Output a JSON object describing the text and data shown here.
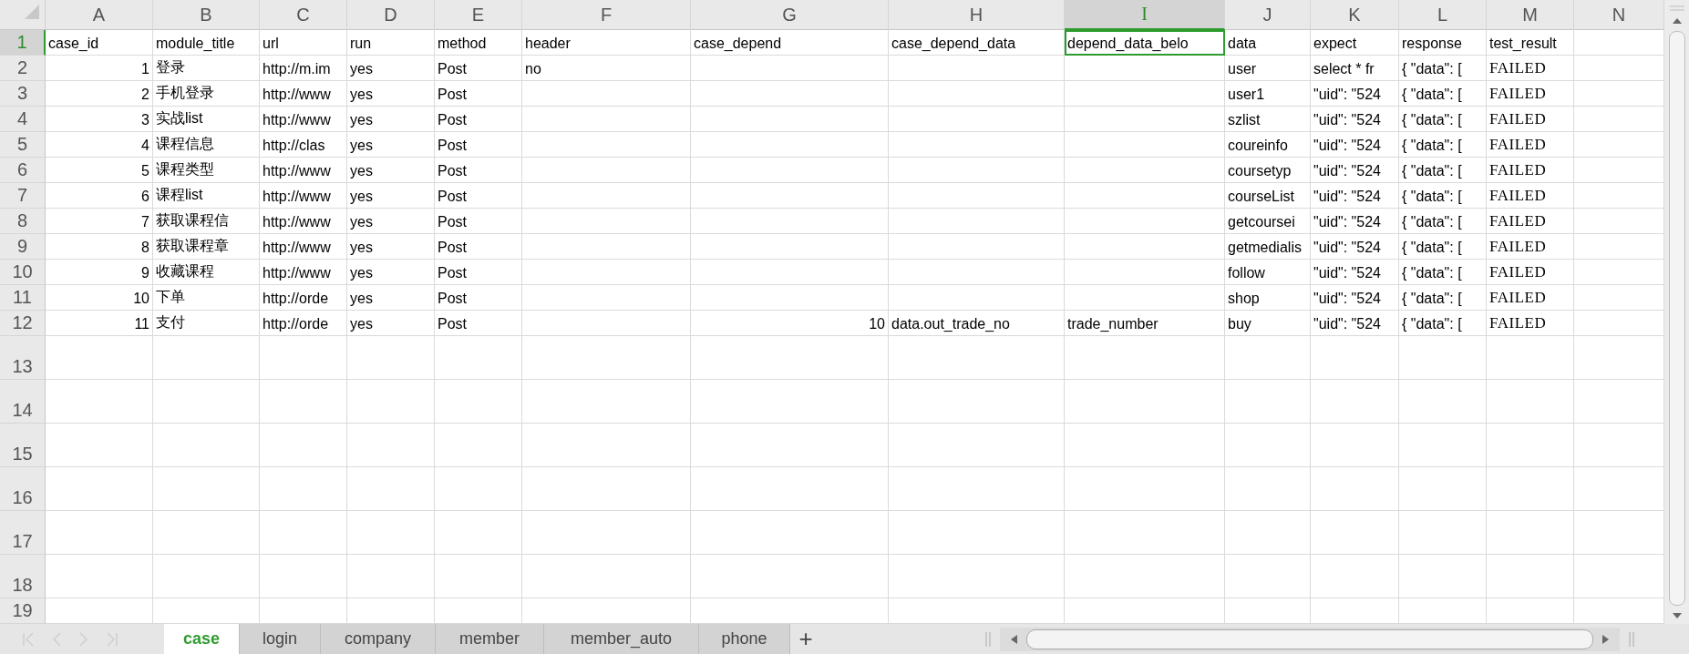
{
  "columns": [
    {
      "label": "A",
      "selected": false
    },
    {
      "label": "B",
      "selected": false
    },
    {
      "label": "C",
      "selected": false
    },
    {
      "label": "D",
      "selected": false
    },
    {
      "label": "E",
      "selected": false
    },
    {
      "label": "F",
      "selected": false
    },
    {
      "label": "G",
      "selected": false
    },
    {
      "label": "H",
      "selected": false
    },
    {
      "label": "I",
      "selected": true
    },
    {
      "label": "J",
      "selected": false
    },
    {
      "label": "K",
      "selected": false
    },
    {
      "label": "L",
      "selected": false
    },
    {
      "label": "M",
      "selected": false
    },
    {
      "label": "N",
      "selected": false
    }
  ],
  "rows": [
    {
      "number": "1",
      "selected": true,
      "cells": [
        "case_id",
        "module_title",
        "url",
        "run",
        "method",
        "header",
        "case_depend",
        "case_depend_data",
        "depend_data_belo",
        "data",
        "expect",
        "response",
        "test_result",
        null
      ]
    },
    {
      "number": "2",
      "selected": false,
      "cells": [
        {
          "kind": "number",
          "text": "1"
        },
        "登录",
        "http://m.im",
        "yes",
        "Post",
        "no",
        null,
        null,
        null,
        "user",
        "select * fr",
        "{  \"data\": [",
        {
          "kind": "result",
          "text": "FAILED"
        },
        null
      ]
    },
    {
      "number": "3",
      "selected": false,
      "cells": [
        {
          "kind": "number",
          "text": "2"
        },
        "手机登录",
        "http://www",
        "yes",
        "Post",
        null,
        null,
        null,
        null,
        "user1",
        "\"uid\": \"524",
        "{  \"data\": [",
        {
          "kind": "result",
          "text": "FAILED"
        },
        null
      ]
    },
    {
      "number": "4",
      "selected": false,
      "cells": [
        {
          "kind": "number",
          "text": "3"
        },
        "实战list",
        "http://www",
        "yes",
        "Post",
        null,
        null,
        null,
        null,
        "szlist",
        "\"uid\": \"524",
        "{  \"data\": [",
        {
          "kind": "result",
          "text": "FAILED"
        },
        null
      ]
    },
    {
      "number": "5",
      "selected": false,
      "cells": [
        {
          "kind": "number",
          "text": "4"
        },
        "课程信息",
        "http://clas",
        "yes",
        "Post",
        null,
        null,
        null,
        null,
        "coureinfo",
        "\"uid\": \"524",
        "{  \"data\": [",
        {
          "kind": "result",
          "text": "FAILED"
        },
        null
      ]
    },
    {
      "number": "6",
      "selected": false,
      "cells": [
        {
          "kind": "number",
          "text": "5"
        },
        "课程类型",
        "http://www",
        "yes",
        "Post",
        null,
        null,
        null,
        null,
        "coursetyp",
        "\"uid\": \"524",
        "{  \"data\": [",
        {
          "kind": "result",
          "text": "FAILED"
        },
        null
      ]
    },
    {
      "number": "7",
      "selected": false,
      "cells": [
        {
          "kind": "number",
          "text": "6"
        },
        "课程list",
        "http://www",
        "yes",
        "Post",
        null,
        null,
        null,
        null,
        "courseList",
        "\"uid\": \"524",
        "{  \"data\": [",
        {
          "kind": "result",
          "text": "FAILED"
        },
        null
      ]
    },
    {
      "number": "8",
      "selected": false,
      "cells": [
        {
          "kind": "number",
          "text": "7"
        },
        "获取课程信",
        "http://www",
        "yes",
        "Post",
        null,
        null,
        null,
        null,
        "getcoursei",
        "\"uid\": \"524",
        "{  \"data\": [",
        {
          "kind": "result",
          "text": "FAILED"
        },
        null
      ]
    },
    {
      "number": "9",
      "selected": false,
      "cells": [
        {
          "kind": "number",
          "text": "8"
        },
        "获取课程章",
        "http://www",
        "yes",
        "Post",
        null,
        null,
        null,
        null,
        "getmedialis",
        "\"uid\": \"524",
        "{  \"data\": [",
        {
          "kind": "result",
          "text": "FAILED"
        },
        null
      ]
    },
    {
      "number": "10",
      "selected": false,
      "cells": [
        {
          "kind": "number",
          "text": "9"
        },
        "收藏课程",
        "http://www",
        "yes",
        "Post",
        null,
        null,
        null,
        null,
        "follow",
        "\"uid\": \"524",
        "{  \"data\": [",
        {
          "kind": "result",
          "text": "FAILED"
        },
        null
      ]
    },
    {
      "number": "11",
      "selected": false,
      "cells": [
        {
          "kind": "number",
          "text": "10"
        },
        "下单",
        "http://orde",
        "yes",
        "Post",
        null,
        null,
        null,
        null,
        "shop",
        "\"uid\": \"524",
        "{  \"data\": [",
        {
          "kind": "result",
          "text": "FAILED"
        },
        null
      ]
    },
    {
      "number": "12",
      "selected": false,
      "cells": [
        {
          "kind": "number",
          "text": "11"
        },
        "支付",
        "http://orde",
        "yes",
        "Post",
        null,
        {
          "kind": "number",
          "text": "10"
        },
        "data.out_trade_no",
        "trade_number",
        "buy",
        "\"uid\": \"524",
        "{  \"data\": [",
        {
          "kind": "result",
          "text": "FAILED"
        },
        null
      ]
    }
  ],
  "empty_rows": [
    "13",
    "14",
    "15",
    "16",
    "17",
    "18",
    "19"
  ],
  "sheet_tabs": [
    {
      "label": "case",
      "selected": true
    },
    {
      "label": "login",
      "selected": false
    },
    {
      "label": "company",
      "selected": false
    },
    {
      "label": "member",
      "selected": false
    },
    {
      "label": "member_auto",
      "selected": false
    },
    {
      "label": "phone",
      "selected": false
    }
  ],
  "add_sheet": "+"
}
